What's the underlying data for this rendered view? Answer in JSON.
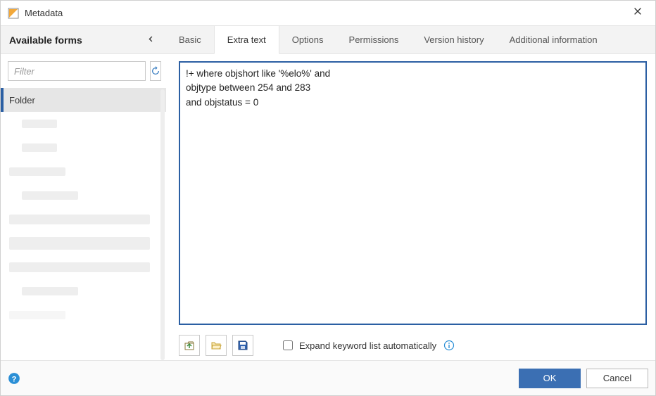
{
  "window": {
    "title": "Metadata"
  },
  "forms": {
    "heading": "Available forms",
    "filter_placeholder": "Filter",
    "selected_label": "Folder"
  },
  "tabs": [
    {
      "label": "Basic",
      "active": false
    },
    {
      "label": "Extra text",
      "active": true
    },
    {
      "label": "Options",
      "active": false
    },
    {
      "label": "Permissions",
      "active": false
    },
    {
      "label": "Version history",
      "active": false
    },
    {
      "label": "Additional information",
      "active": false
    }
  ],
  "editor": {
    "text": "!+ where objshort like '%elo%' and\nobjtype between 254 and 283\nand objstatus = 0"
  },
  "toolbar": {
    "expand_label": "Expand keyword list automatically",
    "expand_checked": false
  },
  "buttons": {
    "ok": "OK",
    "cancel": "Cancel"
  }
}
